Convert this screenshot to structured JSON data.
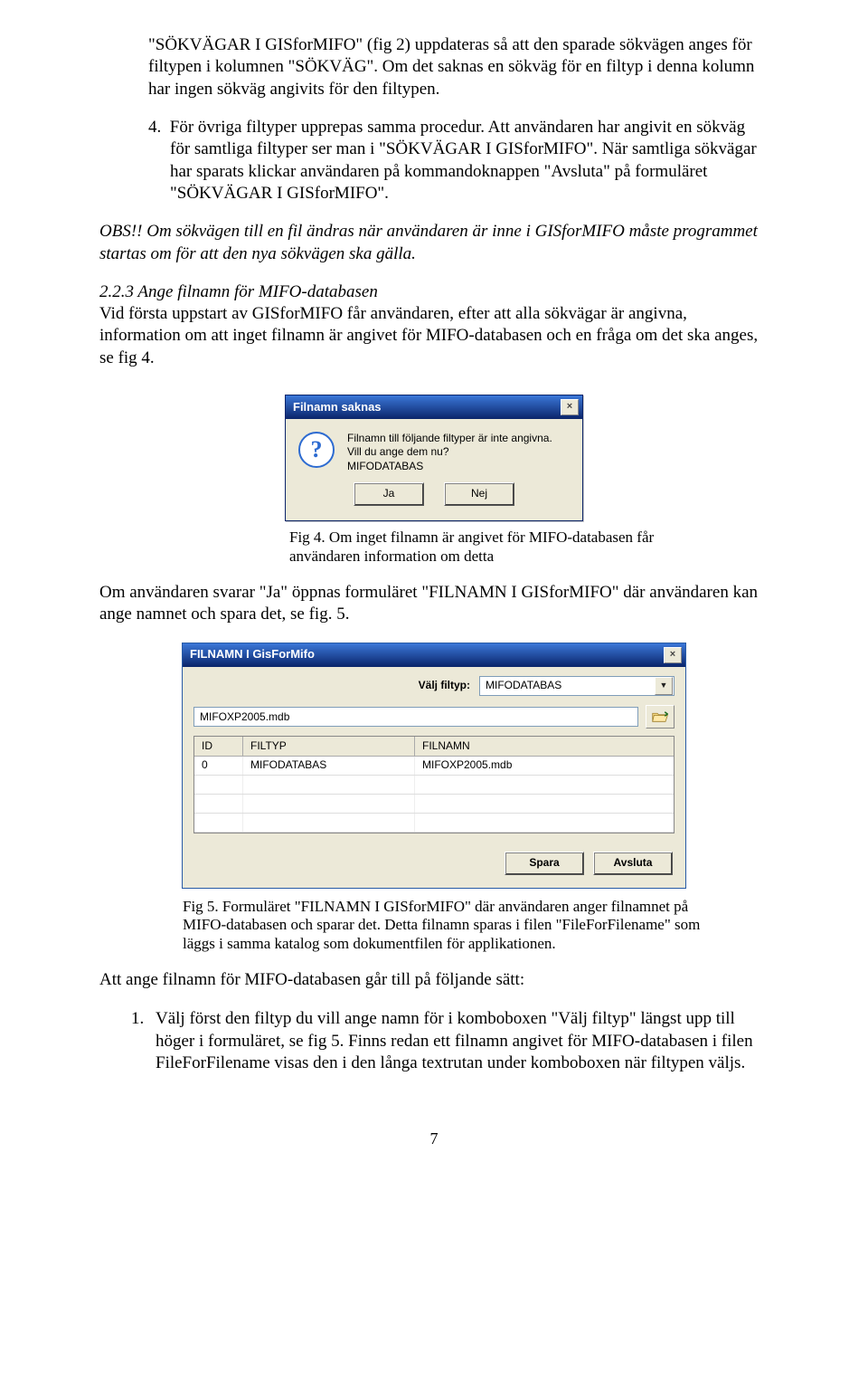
{
  "para_top": "\"SÖKVÄGAR I GISforMIFO\" (fig 2) uppdateras så att den sparade sökvägen anges för filtypen i kolumnen \"SÖKVÄG\". Om det saknas en sökväg för en filtyp i denna kolumn har ingen sökväg angivits för den filtypen.",
  "item4": "För övriga filtyper upprepas samma procedur. Att användaren har angivit en sökväg för samtliga filtyper ser man i \"SÖKVÄGAR I GISforMIFO\". När samtliga sökvägar har sparats klickar användaren på kommandoknappen \"Avsluta\" på formuläret \"SÖKVÄGAR I GISforMIFO\".",
  "obs": "OBS!! Om sökvägen till en fil ändras när användaren är inne i GISforMIFO måste programmet startas om för att den nya sökvägen ska gälla.",
  "sec223_title": "2.2.3    Ange filnamn för MIFO-databasen",
  "sec223_body": "Vid första uppstart av GISforMIFO får användaren, efter att alla sökvägar är angivna, information om att inget filnamn är angivet för MIFO-databasen och en fråga om det ska anges, se fig 4.",
  "dialog1": {
    "title": "Filnamn saknas",
    "line1": "Filnamn till följande filtyper är inte angivna.",
    "line2": "Vill du ange dem nu?",
    "line3": "MIFODATABAS",
    "yes": "Ja",
    "no": "Nej",
    "close": "×"
  },
  "caption4": "Fig 4. Om inget filnamn är angivet för MIFO-databasen får användaren information om detta",
  "para_after4": "Om användaren svarar \"Ja\" öppnas formuläret \"FILNAMN I GISforMIFO\" där användaren kan ange namnet och spara det, se fig. 5.",
  "dialog2": {
    "title": "FILNAMN I GisForMifo",
    "close": "×",
    "choose_label": "Välj filtyp:",
    "combo_value": "MIFODATABAS",
    "filename_value": "MIFOXP2005.mdb",
    "headers": {
      "id": "ID",
      "filtyp": "FILTYP",
      "filnamn": "FILNAMN"
    },
    "row": {
      "id": "0",
      "filtyp": "MIFODATABAS",
      "filnamn": "MIFOXP2005.mdb"
    },
    "save": "Spara",
    "close_btn": "Avsluta"
  },
  "caption5": "Fig 5. Formuläret \"FILNAMN I GISforMIFO\" där användaren anger filnamnet på MIFO-databasen och sparar det. Detta filnamn sparas i filen \"FileForFilename\" som läggs i samma katalog som dokumentfilen för applikationen.",
  "para_after5": "Att ange filnamn för MIFO-databasen går till på följande sätt:",
  "step1": "Välj först den filtyp du vill ange namn för i komboboxen \"Välj filtyp\" längst upp till höger i formuläret, se fig 5. Finns redan ett filnamn angivet för MIFO-databasen i filen FileForFilename visas den i den långa textrutan under komboboxen när filtypen väljs.",
  "pagenum": "7"
}
